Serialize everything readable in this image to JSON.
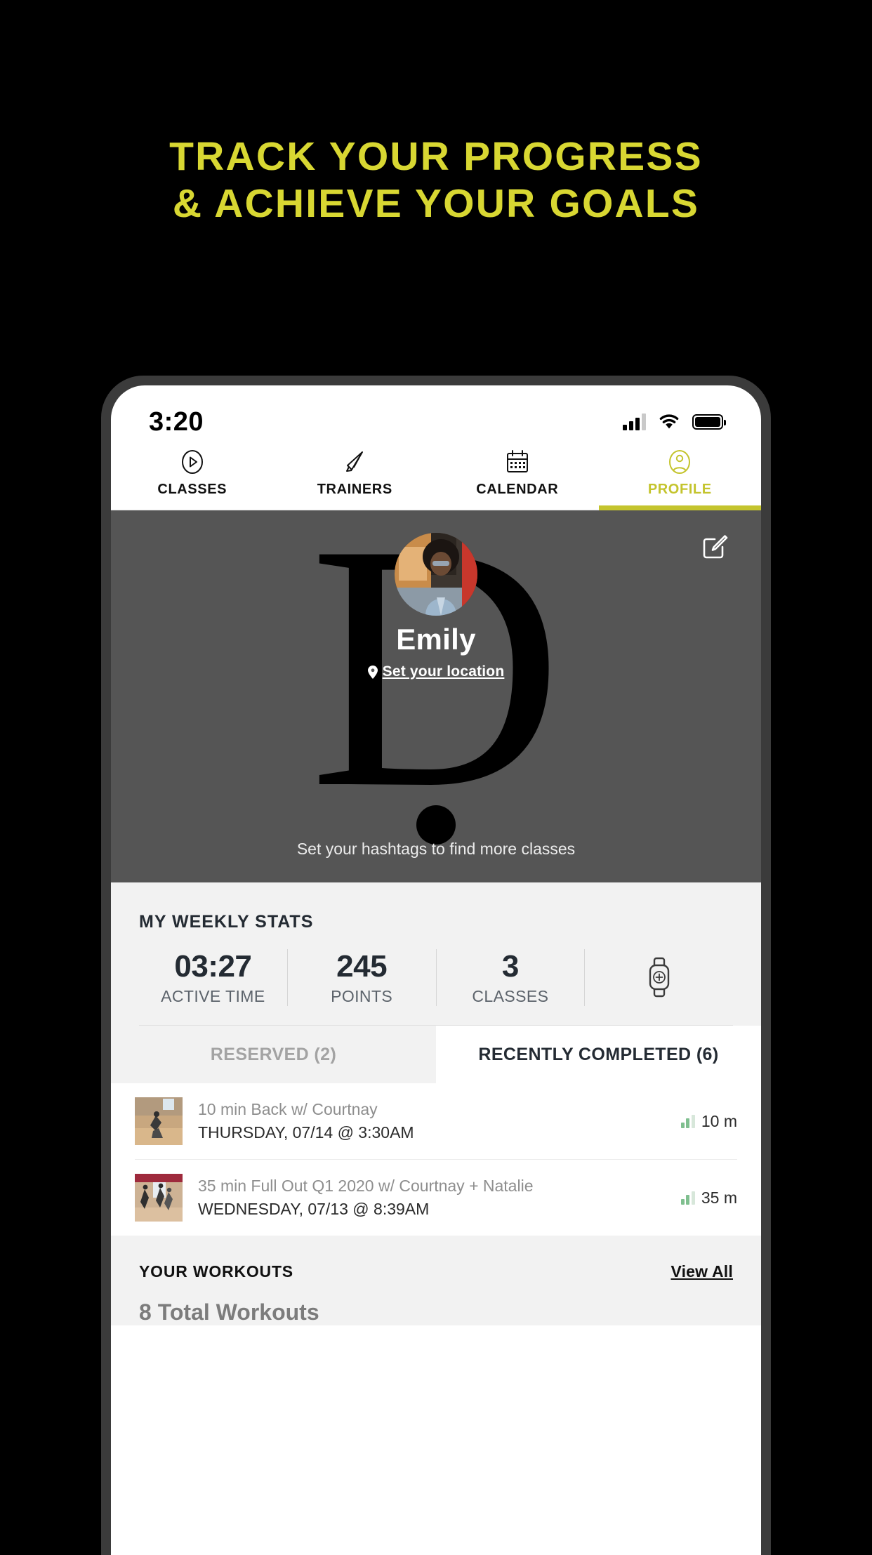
{
  "promo": {
    "line1": "TRACK YOUR PROGRESS",
    "line2": "& ACHIEVE YOUR GOALS",
    "color": "#d8d732",
    "background": "#000000"
  },
  "status_bar": {
    "time": "3:20",
    "signal_icon": "cellular-signal-icon",
    "signal_bars_filled": 3,
    "signal_bars_total": 4,
    "wifi_icon": "wifi-icon",
    "battery_icon": "battery-full-icon"
  },
  "top_tabs": {
    "active_index": 3,
    "accent": "#c4c42e",
    "items": [
      {
        "label": "CLASSES",
        "icon": "play-circle-icon"
      },
      {
        "label": "TRAINERS",
        "icon": "megaphone-icon"
      },
      {
        "label": "CALENDAR",
        "icon": "calendar-icon"
      },
      {
        "label": "PROFILE",
        "icon": "user-circle-icon"
      }
    ]
  },
  "profile": {
    "background_letter": "D",
    "name": "Emily",
    "location_link": "Set your location",
    "location_icon": "map-pin-icon",
    "edit_icon": "edit-pencil-square-icon",
    "avatar_icon": "user-avatar-photo",
    "hashtags_prompt": "Set your hashtags to find more classes",
    "background_color": "#555555"
  },
  "weekly_stats": {
    "title": "MY WEEKLY STATS",
    "items": [
      {
        "value": "03:27",
        "label": "ACTIVE TIME"
      },
      {
        "value": "245",
        "label": "POINTS"
      },
      {
        "value": "3",
        "label": "CLASSES"
      }
    ],
    "watch_icon": "add-watch-icon"
  },
  "class_tabs": {
    "active_index": 1,
    "items": [
      {
        "label": "RESERVED (2)"
      },
      {
        "label": "RECENTLY COMPLETED (6)"
      }
    ]
  },
  "classes": [
    {
      "title": "10 min Back w/ Courtnay",
      "date": "THURSDAY, 07/14 @ 3:30AM",
      "duration": "10 m",
      "thumb_icon": "class-thumbnail-dancer",
      "bars_icon": "intensity-bars-icon"
    },
    {
      "title": "35 min Full Out Q1 2020 w/ Courtnay + Natalie",
      "date": "WEDNESDAY, 07/13 @ 8:39AM",
      "duration": "35 m",
      "thumb_icon": "class-thumbnail-dancers",
      "bars_icon": "intensity-bars-icon"
    }
  ],
  "workouts": {
    "title": "YOUR WORKOUTS",
    "view_all": "View All",
    "total": "8 Total Workouts"
  }
}
